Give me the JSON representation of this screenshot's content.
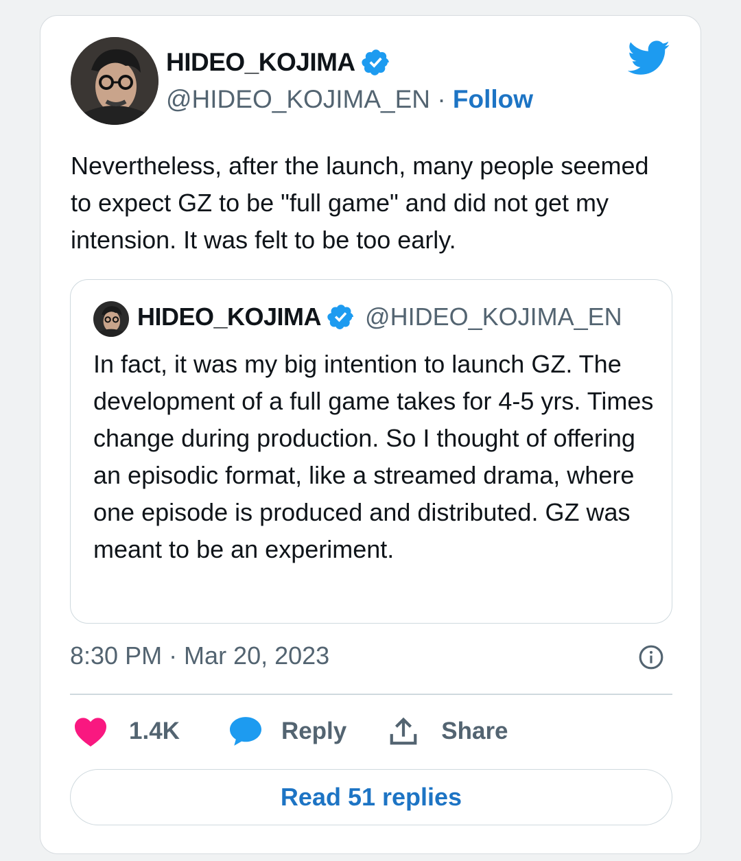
{
  "author": {
    "name": "HIDEO_KOJIMA",
    "handle": "@HIDEO_KOJIMA_EN",
    "separator": "·",
    "follow_label": "Follow",
    "verified_icon": "verified-badge-icon"
  },
  "tweet": {
    "text": "Nevertheless, after the launch, many people seemed to expect GZ to be \"full game\" and did not get my intension. It was felt to be too early.",
    "timestamp": "8:30 PM · Mar 20, 2023"
  },
  "quoted_tweet": {
    "name": "HIDEO_KOJIMA",
    "handle": "@HIDEO_KOJIMA_EN",
    "text": "In fact, it was my big intention to launch GZ. The development of a full game takes for 4-5 yrs. Times change during production. So I thought of offering an episodic format, like a streamed drama, where one episode is produced and distributed. GZ was meant to be an experiment."
  },
  "actions": {
    "likes": "1.4K",
    "reply_label": "Reply",
    "share_label": "Share"
  },
  "read_replies_label": "Read 51 replies",
  "colors": {
    "accent": "#1d74c4",
    "twitter_blue": "#1d9bf0",
    "like_pink": "#f91880",
    "muted": "#536471",
    "border": "#cfd9de"
  }
}
